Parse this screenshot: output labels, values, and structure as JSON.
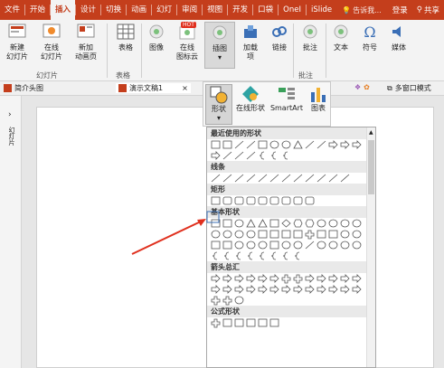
{
  "tabs": [
    "文件",
    "开始",
    "插入",
    "设计",
    "切换",
    "动画",
    "幻灯",
    "审阅",
    "视图",
    "开发",
    "口袋",
    "OneI",
    "iSlide"
  ],
  "active_tab": "插入",
  "tell_me": "告诉我...",
  "login": "登录",
  "share": "共享",
  "ribbon": {
    "new_slide": "新建\n幻灯片",
    "online_slide": "在线\n幻灯片",
    "new_animation": "新加\n动画页",
    "table": "表格",
    "image": "图像",
    "online_icons": "在线\n图标云",
    "illustrations": "插图",
    "addins": "加载\n项",
    "links": "链接",
    "comment": "批注",
    "text": "文本",
    "symbols": "符号",
    "media": "媒体",
    "group_slides": "幻灯片",
    "group_table": "表格",
    "group_comments": "批注",
    "hot_badge": "HOT"
  },
  "doc_tabs": {
    "tab1": "简介头图",
    "tab2": "演示文稿1",
    "close": "×",
    "multi_window": "多窗口模式"
  },
  "left_panel": {
    "toggle": "›",
    "label": "幻灯片"
  },
  "flyout": {
    "shapes": "形状",
    "online_shapes": "在线形状",
    "smartart": "SmartArt",
    "chart": "图表"
  },
  "gallery": {
    "sections": [
      "最近使用的形状",
      "线条",
      "矩形",
      "基本形状",
      "箭头总汇",
      "公式形状"
    ]
  },
  "colors": {
    "accent": "#c43e1c",
    "arrow": "#e0301e"
  }
}
